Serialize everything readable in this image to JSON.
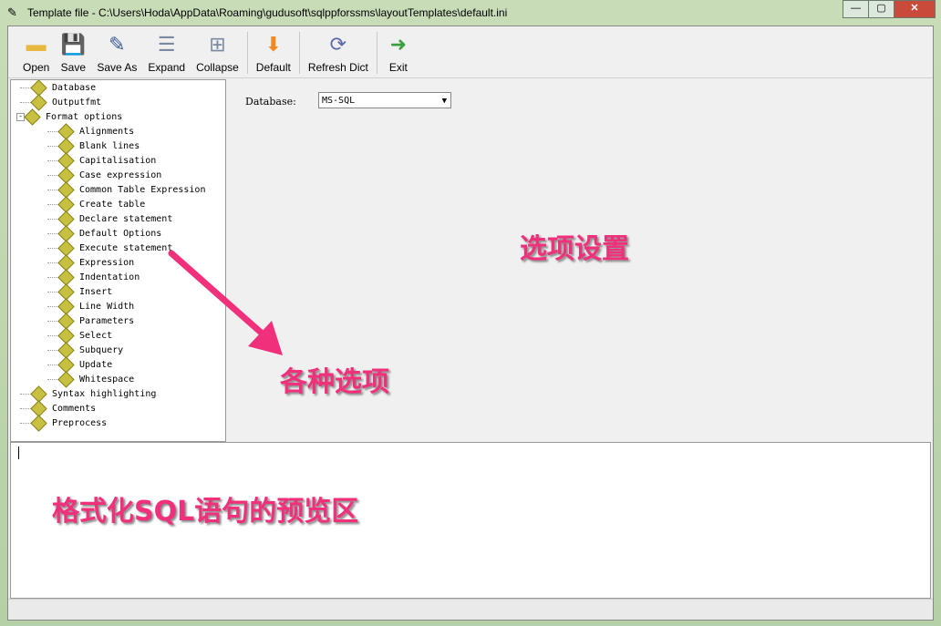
{
  "window": {
    "title": "Template file  - C:\\Users\\Hoda\\AppData\\Roaming\\gudusoft\\sqlppforssms\\layoutTemplates\\default.ini"
  },
  "toolbar": [
    {
      "label": "Open",
      "icon": "folder-icon"
    },
    {
      "label": "Save",
      "icon": "floppy-icon"
    },
    {
      "label": "Save As",
      "icon": "save-as-icon"
    },
    {
      "label": "Expand",
      "icon": "expand-icon"
    },
    {
      "label": "Collapse",
      "icon": "collapse-icon"
    },
    {
      "label": "Default",
      "icon": "default-icon"
    },
    {
      "label": "Refresh Dict",
      "icon": "refresh-icon"
    },
    {
      "label": "Exit",
      "icon": "exit-icon"
    }
  ],
  "tree": [
    {
      "label": "Database",
      "level": 0
    },
    {
      "label": "Outputfmt",
      "level": 0
    },
    {
      "label": "Format options",
      "level": 0,
      "expanded": true
    },
    {
      "label": "Alignments",
      "level": 1
    },
    {
      "label": "Blank lines",
      "level": 1
    },
    {
      "label": "Capitalisation",
      "level": 1
    },
    {
      "label": "Case expression",
      "level": 1
    },
    {
      "label": "Common Table Expression",
      "level": 1
    },
    {
      "label": "Create table",
      "level": 1
    },
    {
      "label": "Declare statement",
      "level": 1
    },
    {
      "label": "Default Options",
      "level": 1
    },
    {
      "label": "Execute statement",
      "level": 1
    },
    {
      "label": "Expression",
      "level": 1
    },
    {
      "label": "Indentation",
      "level": 1
    },
    {
      "label": "Insert",
      "level": 1
    },
    {
      "label": "Line Width",
      "level": 1
    },
    {
      "label": "Parameters",
      "level": 1
    },
    {
      "label": "Select",
      "level": 1
    },
    {
      "label": "Subquery",
      "level": 1
    },
    {
      "label": "Update",
      "level": 1
    },
    {
      "label": "Whitespace",
      "level": 1
    },
    {
      "label": "Syntax highlighting",
      "level": 0
    },
    {
      "label": "Comments",
      "level": 0
    },
    {
      "label": "Preprocess",
      "level": 0
    }
  ],
  "options": {
    "database_label": "Database:",
    "database_value": "MS-SQL"
  },
  "annotations": {
    "options_area": "选项设置",
    "tree_area": "各种选项",
    "preview_area": "格式化SQL语句的预览区",
    "color": "#f0307a"
  }
}
